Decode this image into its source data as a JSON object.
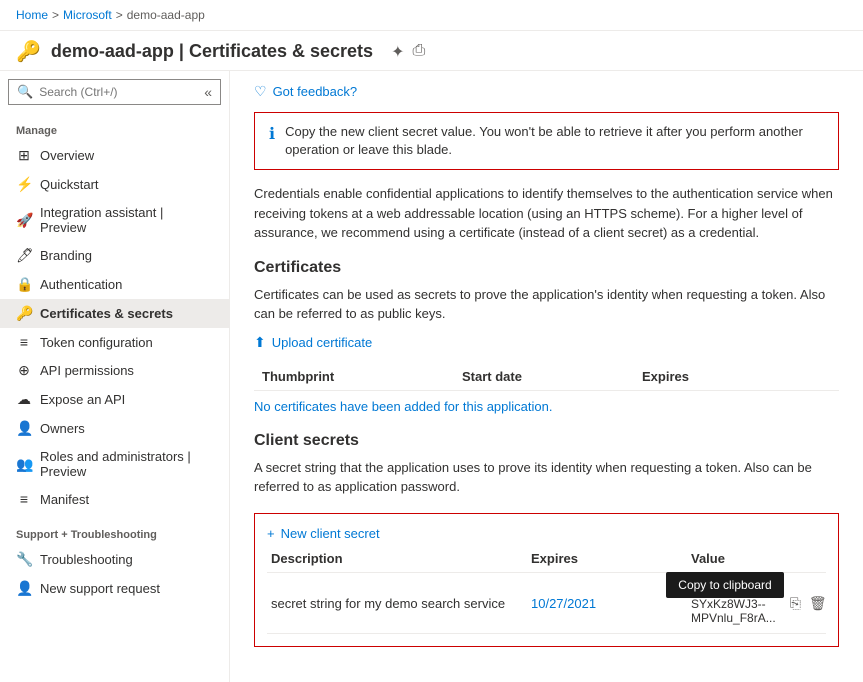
{
  "breadcrumb": {
    "home": "Home",
    "separator1": ">",
    "microsoft": "Microsoft",
    "separator2": ">",
    "app": "demo-aad-app"
  },
  "header": {
    "icon": "🔑",
    "title": "demo-aad-app | Certificates & secrets",
    "pin_icon": "⊹",
    "print_icon": "🖨"
  },
  "sidebar": {
    "search_placeholder": "Search (Ctrl+/)",
    "collapse_icon": "«",
    "manage_label": "Manage",
    "items": [
      {
        "id": "overview",
        "icon": "⊞",
        "label": "Overview"
      },
      {
        "id": "quickstart",
        "icon": "☁",
        "label": "Quickstart"
      },
      {
        "id": "integration",
        "icon": "🚀",
        "label": "Integration assistant | Preview"
      },
      {
        "id": "branding",
        "icon": "⊟",
        "label": "Branding"
      },
      {
        "id": "authentication",
        "icon": "🔒",
        "label": "Authentication"
      },
      {
        "id": "certificates",
        "icon": "🔑",
        "label": "Certificates & secrets",
        "active": true
      },
      {
        "id": "token",
        "icon": "≡",
        "label": "Token configuration"
      },
      {
        "id": "api",
        "icon": "⊕",
        "label": "API permissions"
      },
      {
        "id": "expose",
        "icon": "☁",
        "label": "Expose an API"
      },
      {
        "id": "owners",
        "icon": "👤",
        "label": "Owners"
      },
      {
        "id": "roles",
        "icon": "👥",
        "label": "Roles and administrators | Preview"
      },
      {
        "id": "manifest",
        "icon": "≡",
        "label": "Manifest"
      }
    ],
    "support_label": "Support + Troubleshooting",
    "support_items": [
      {
        "id": "troubleshooting",
        "icon": "🔧",
        "label": "Troubleshooting"
      },
      {
        "id": "new-support",
        "icon": "👤",
        "label": "New support request"
      }
    ]
  },
  "content": {
    "feedback": {
      "icon": "♡",
      "label": "Got feedback?"
    },
    "alert": {
      "icon": "ℹ",
      "text": "Copy the new client secret value. You won't be able to retrieve it after you perform another operation or leave this blade."
    },
    "description": "Credentials enable confidential applications to identify themselves to the authentication service when receiving tokens at a web addressable location (using an HTTPS scheme). For a higher level of assurance, we recommend using a certificate (instead of a client secret) as a credential.",
    "certificates": {
      "title": "Certificates",
      "description": "Certificates can be used as secrets to prove the application's identity when requesting a token. Also can be referred to as public keys.",
      "upload_label": "Upload certificate",
      "columns": [
        "Thumbprint",
        "Start date",
        "Expires"
      ],
      "no_data": "No certificates have been added for this application."
    },
    "client_secrets": {
      "title": "Client secrets",
      "description": "A secret string that the application uses to prove its identity when requesting a token. Also can be referred to as application password.",
      "new_secret_label": "+ New client secret",
      "columns": [
        "Description",
        "Expires",
        "Value"
      ],
      "rows": [
        {
          "description": "secret string for my demo search service",
          "expires": "10/27/2021",
          "value": "2J1wyZfiF-SYxKz8WJ3--MPVnlu_F8rA..."
        }
      ],
      "tooltip": "Copy to clipboard"
    }
  }
}
